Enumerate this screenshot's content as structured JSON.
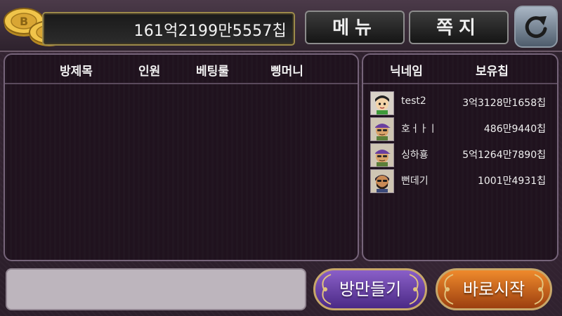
{
  "header": {
    "chips": "161억2199만5557칩",
    "menu_label": "메뉴",
    "message_label": "쪽지"
  },
  "rooms": {
    "columns": [
      "방제목",
      "인원",
      "베팅룰",
      "삥머니"
    ]
  },
  "users": {
    "columns": [
      "닉네임",
      "보유칩"
    ],
    "rows": [
      {
        "name": "test2",
        "chips": "3억3128만1658칩",
        "avatar": "boy-green-shirt"
      },
      {
        "name": "호ㅓㅏㅣ",
        "chips": "486만9440칩",
        "avatar": "man-cap-sunglasses"
      },
      {
        "name": "싱하횽",
        "chips": "5억1264만7890칩",
        "avatar": "man-cap-sunglasses"
      },
      {
        "name": "뻔데기",
        "chips": "1001만4931칩",
        "avatar": "man-beard"
      }
    ]
  },
  "buttons": {
    "create_room": "방만들기",
    "quick_start": "바로시작"
  },
  "colors": {
    "create_button": "#6a45a8",
    "quick_start_button": "#d46a1f",
    "coin_gold": "#e0b13a"
  }
}
